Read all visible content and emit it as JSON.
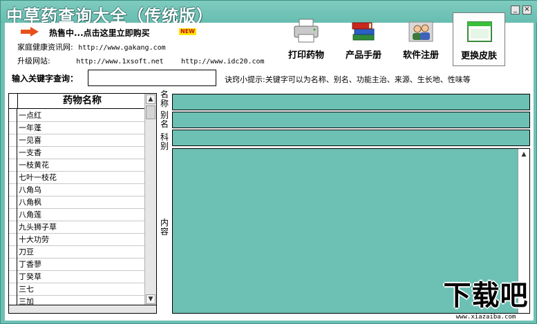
{
  "window": {
    "title": "中草药查询大全（传统版）",
    "minimize_glyph": "_",
    "close_glyph": "×"
  },
  "promo": {
    "text": "热售中...点击这里立即购买",
    "badge": "NEW"
  },
  "sites": {
    "family_label": "家庭健康资讯网:",
    "family_url": "http://www.gakang.com",
    "upgrade_label": "升级网站:",
    "upgrade_url_1": "http://www.1xsoft.net",
    "upgrade_url_2": "http://www.idc20.com"
  },
  "toolbar": {
    "print_label": "打印药物",
    "manual_label": "产品手册",
    "register_label": "软件注册",
    "skin_label": "更换皮肤"
  },
  "search": {
    "label": "输入关键字查询：",
    "value": "",
    "hint": "诀窍小提示:关键字可以为名称、别名、功能主治、来源、生长地、性味等"
  },
  "list": {
    "header": "药物名称",
    "items": [
      "一点红",
      "一年蓬",
      "一见喜",
      "一支香",
      "一枝黄花",
      "七叶一枝花",
      "八角乌",
      "八角枫",
      "八角莲",
      "九头狮子草",
      "十大功劳",
      "刀豆",
      "丁香蓼",
      "丁癸草",
      "三七",
      "三加"
    ]
  },
  "detail": {
    "name_label": "名称",
    "alias_label": "别名",
    "family_label": "科别",
    "content_label": "内容"
  },
  "watermark": {
    "brand": "下载吧",
    "url": "www.xiazaiba.com"
  },
  "colors": {
    "teal": "#6cc0b4",
    "arrow": "#e8501a"
  }
}
